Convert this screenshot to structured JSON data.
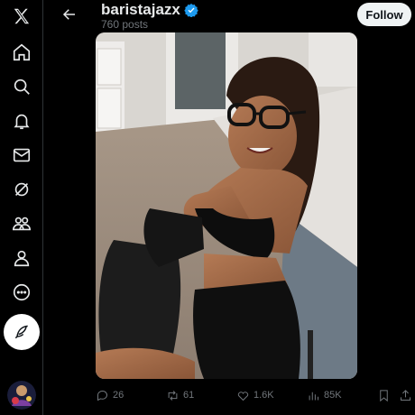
{
  "header": {
    "back_icon": "arrow-left-icon",
    "handle": "baristajazx",
    "verified_icon": "verified-badge-icon",
    "verified_color": "#1d9bf0",
    "posts_count": "760 posts",
    "follow_label": "Follow"
  },
  "nav": {
    "logo_icon": "x-logo-icon",
    "items": [
      {
        "icon": "home-icon"
      },
      {
        "icon": "search-icon"
      },
      {
        "icon": "bell-icon"
      },
      {
        "icon": "mail-icon"
      },
      {
        "icon": "grok-icon"
      },
      {
        "icon": "communities-icon"
      },
      {
        "icon": "profile-icon"
      },
      {
        "icon": "more-icon"
      }
    ],
    "compose_icon": "feather-icon"
  },
  "actions": {
    "replies": "26",
    "reposts": "61",
    "likes": "1.6K",
    "views": "85K"
  },
  "colors": {
    "background": "#000000",
    "muted_text": "#71767b",
    "follow_bg": "#eff3f4"
  }
}
